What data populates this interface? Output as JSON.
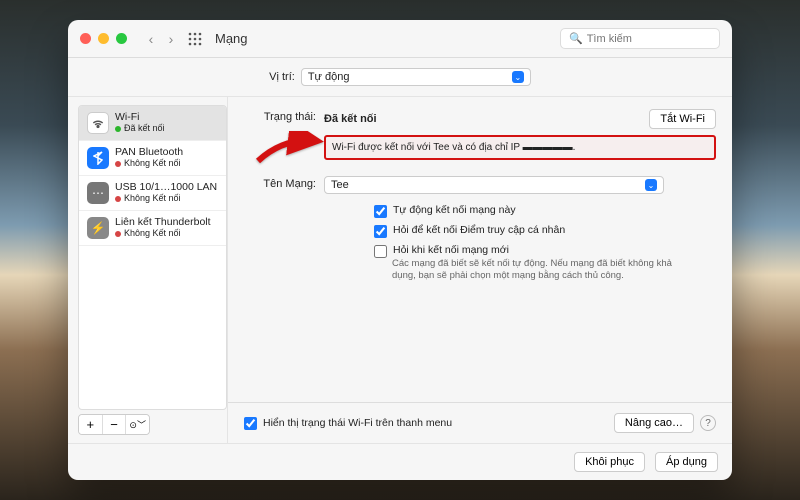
{
  "titlebar": {
    "title": "Mạng",
    "search_placeholder": "Tìm kiếm"
  },
  "location": {
    "label": "Vị trí:",
    "value": "Tự động"
  },
  "sidebar": {
    "items": [
      {
        "name": "Wi-Fi",
        "status": "Đã kết nối",
        "color": "green",
        "icon": "wifi"
      },
      {
        "name": "PAN Bluetooth",
        "status": "Không Kết nối",
        "color": "red",
        "icon": "bt"
      },
      {
        "name": "USB 10/1…1000 LAN",
        "status": "Không Kết nối",
        "color": "red",
        "icon": "usb"
      },
      {
        "name": "Liên kết Thunderbolt",
        "status": "Không Kết nối",
        "color": "red",
        "icon": "tb"
      }
    ],
    "add": "+",
    "remove": "−",
    "more": "⊙﹀"
  },
  "main": {
    "status_label": "Trạng thái:",
    "status_value": "Đã kết nối",
    "turn_off": "Tắt Wi-Fi",
    "connected_detail": "Wi-Fi được kết nối với Tee và có địa chỉ IP ▬▬▬▬▬.",
    "network_label": "Tên Mạng:",
    "network_value": "Tee",
    "checks": {
      "auto_join": "Tự động kết nối mạng này",
      "ask_hotspot": "Hỏi để kết nối Điểm truy cập cá nhân",
      "ask_new": "Hỏi khi kết nối mạng mới",
      "ask_new_help": "Các mạng đã biết sẽ kết nối tự động. Nếu mạng đã biết không khả dụng, bạn sẽ phải chọn một mạng bằng cách thủ công."
    },
    "show_menu": "Hiển thị trạng thái Wi-Fi trên thanh menu",
    "advanced": "Nâng cao…"
  },
  "footer": {
    "revert": "Khôi phục",
    "apply": "Áp dụng"
  }
}
